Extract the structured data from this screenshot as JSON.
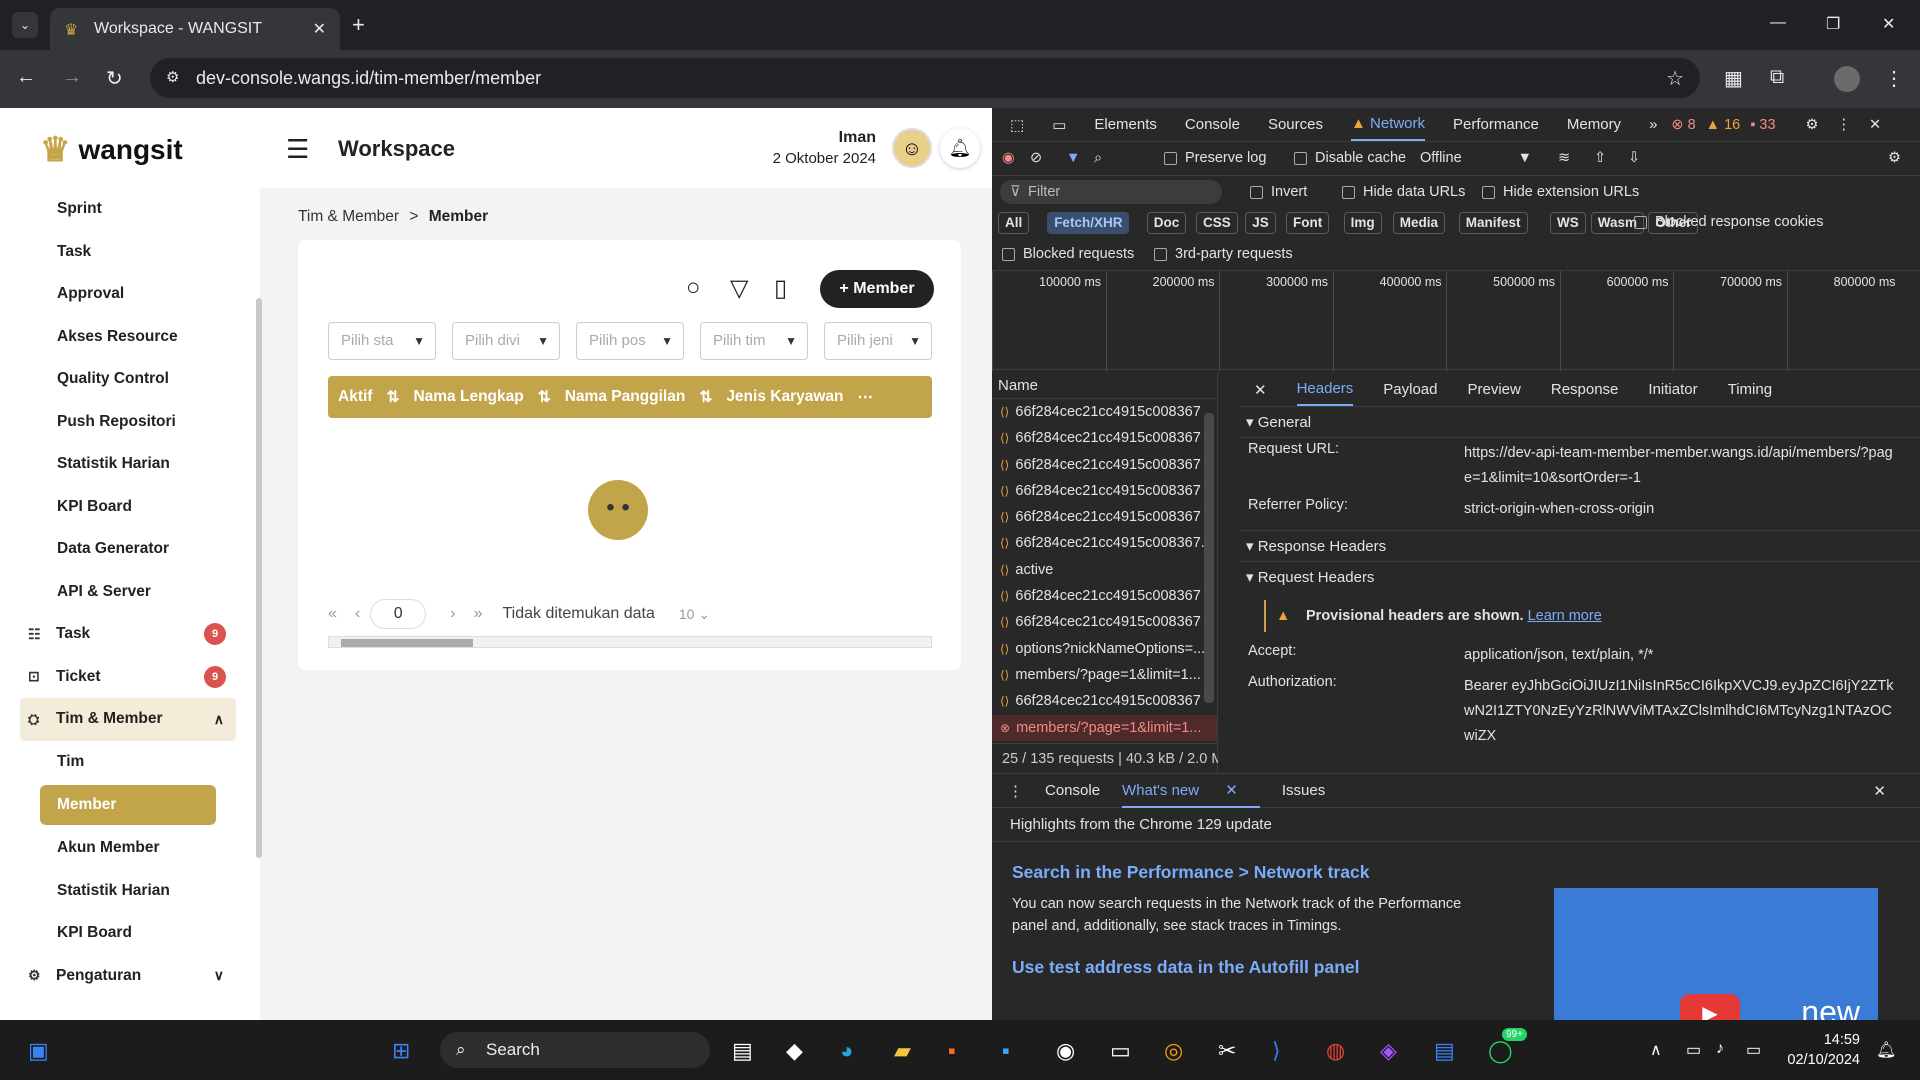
{
  "browser": {
    "tab_title": "Workspace - WANGSIT",
    "url": "dev-console.wangs.id/tim-member/member"
  },
  "app": {
    "brand": "wangsit",
    "page_title": "Workspace",
    "user_name": "Iman",
    "user_date": "2 Oktober 2024"
  },
  "sidebar": {
    "items": [
      {
        "label": "Sprint",
        "type": "sub"
      },
      {
        "label": "Task",
        "type": "sub"
      },
      {
        "label": "Approval",
        "type": "sub"
      },
      {
        "label": "Akses Resource",
        "type": "sub"
      },
      {
        "label": "Quality Control",
        "type": "sub"
      },
      {
        "label": "Push Repositori",
        "type": "sub"
      },
      {
        "label": "Statistik Harian",
        "type": "sub"
      },
      {
        "label": "KPI Board",
        "type": "sub"
      },
      {
        "label": "Data Generator",
        "type": "sub"
      },
      {
        "label": "API & Server",
        "type": "sub"
      },
      {
        "label": "Task",
        "type": "top",
        "badge": "9"
      },
      {
        "label": "Ticket",
        "type": "top",
        "badge": "9"
      },
      {
        "label": "Tim & Member",
        "type": "open"
      },
      {
        "label": "Tim",
        "type": "sub"
      },
      {
        "label": "Member",
        "type": "active"
      },
      {
        "label": "Akun Member",
        "type": "sub"
      },
      {
        "label": "Statistik Harian",
        "type": "sub"
      },
      {
        "label": "KPI Board",
        "type": "sub"
      },
      {
        "label": "Pengaturan",
        "type": "top"
      }
    ]
  },
  "breadcrumb": {
    "parent": "Tim & Member",
    "sep": ">",
    "current": "Member"
  },
  "toolbar": {
    "add_label": "+ Member"
  },
  "filters": [
    "Pilih sta",
    "Pilih divi",
    "Pilih pos",
    "Pilih tim",
    "Pilih jeni"
  ],
  "table": {
    "columns": [
      "Aktif",
      "Nama Lengkap",
      "Nama Panggilan",
      "Jenis Karyawan"
    ]
  },
  "pager": {
    "page": "0",
    "message": "Tidak ditemukan data",
    "size": "10"
  },
  "devtools": {
    "tabs": [
      "Elements",
      "Console",
      "Sources",
      "Network",
      "Performance",
      "Memory"
    ],
    "errors": "8",
    "warnings": "16",
    "messages": "33",
    "preserve_log": "Preserve log",
    "disable_cache": "Disable cache",
    "throttle": "Offline",
    "filter_placeholder": "Filter",
    "invert": "Invert",
    "hide_data": "Hide data URLs",
    "hide_ext": "Hide extension URLs",
    "types": [
      "All",
      "Fetch/XHR",
      "Doc",
      "CSS",
      "JS",
      "Font",
      "Img",
      "Media",
      "Manifest",
      "WS",
      "Wasm",
      "Other"
    ],
    "blocked_cookies": "Blocked response cookies",
    "blocked_req": "Blocked requests",
    "third_party": "3rd-party requests",
    "timeline": [
      "100000 ms",
      "200000 ms",
      "300000 ms",
      "400000 ms",
      "500000 ms",
      "600000 ms",
      "700000 ms",
      "800000 ms"
    ],
    "name_header": "Name",
    "requests": [
      "66f284cec21cc4915c008367",
      "66f284cec21cc4915c008367",
      "66f284cec21cc4915c008367",
      "66f284cec21cc4915c008367",
      "66f284cec21cc4915c008367",
      "66f284cec21cc4915c008367...",
      "active",
      "66f284cec21cc4915c008367",
      "66f284cec21cc4915c008367",
      "options?nickNameOptions=...",
      "members/?page=1&limit=1...",
      "66f284cec21cc4915c008367",
      "members/?page=1&limit=1..."
    ],
    "footer": "25 / 135 requests | 40.3 kB / 2.0 M",
    "detail_tabs": [
      "Headers",
      "Payload",
      "Preview",
      "Response",
      "Initiator",
      "Timing"
    ],
    "general": "General",
    "req_url_k": "Request URL:",
    "req_url_v": "https://dev-api-team-member-member.wangs.id/api/members/?page=1&limit=10&sortOrder=-1",
    "ref_k": "Referrer Policy:",
    "ref_v": "strict-origin-when-cross-origin",
    "resp_headers": "Response Headers",
    "req_headers": "Request Headers",
    "warn": "Provisional headers are shown.",
    "learn": "Learn more",
    "accept_k": "Accept:",
    "accept_v": "application/json, text/plain, */*",
    "auth_k": "Authorization:",
    "auth_v": "Bearer eyJhbGciOiJIUzI1NiIsInR5cCI6IkpXVCJ9.eyJpZCI6IjY2ZTkwN2I1ZTY0NzEyYzRlNWViMTAxZClsImlhdCI6MTcyNzg1NTAzOCwiZX",
    "drawer_tabs": [
      "Console",
      "What's new",
      "Issues"
    ],
    "highlights": "Highlights from the Chrome 129 update",
    "news1_title": "Search in the Performance > Network track",
    "news1_body": "You can now search requests in the Network track of the Performance panel and, additionally, see stack traces in Timings.",
    "news2_title": "Use test address data in the Autofill panel",
    "video_text": "new"
  },
  "taskbar": {
    "search": "Search",
    "time": "14:59",
    "date": "02/10/2024",
    "badge": "99+"
  }
}
